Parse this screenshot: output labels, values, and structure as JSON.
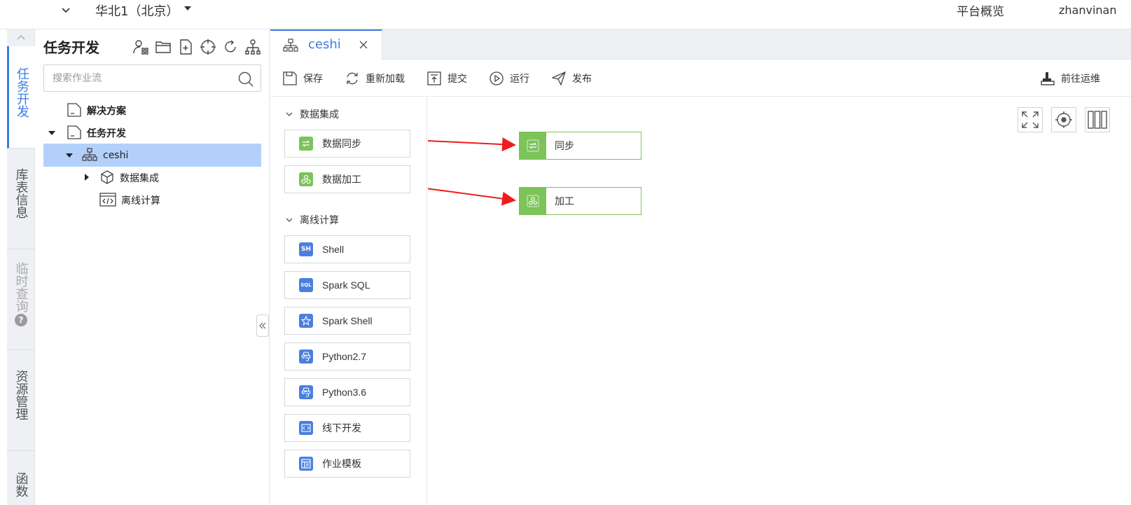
{
  "topbar": {
    "region": "华北1（北京）",
    "overview": "平台概览",
    "user": "zhanvinan"
  },
  "leftnav": {
    "items": [
      {
        "label": "任务开发",
        "state": "active"
      },
      {
        "label": "库表信息",
        "state": "normal"
      },
      {
        "label": "临时查询",
        "state": "disabled"
      },
      {
        "label": "资源管理",
        "state": "normal"
      },
      {
        "label": "函数",
        "state": "normal"
      }
    ]
  },
  "treepanel": {
    "title": "任务开发",
    "search_placeholder": "搜索作业流",
    "rows": [
      {
        "label": "解决方案"
      },
      {
        "label": "任务开发"
      },
      {
        "label": "ceshi"
      },
      {
        "label": "数据集成"
      },
      {
        "label": "离线计算"
      }
    ]
  },
  "editor": {
    "tab": {
      "label": "ceshi"
    },
    "toolbar": {
      "save": "保存",
      "reload": "重新加载",
      "submit": "提交",
      "run": "运行",
      "publish": "发布",
      "ops": "前往运维"
    },
    "palette": {
      "groups": [
        {
          "label": "数据集成",
          "items": [
            {
              "label": "数据同步",
              "icon": "sync-icon"
            },
            {
              "label": "数据加工",
              "icon": "process-icon"
            }
          ]
        },
        {
          "label": "离线计算",
          "items": [
            {
              "label": "Shell",
              "icon": "shell-icon",
              "icon_text": "SH"
            },
            {
              "label": "Spark SQL",
              "icon": "sql-icon",
              "icon_text": "SQL"
            },
            {
              "label": "Spark Shell",
              "icon": "spark-icon"
            },
            {
              "label": "Python2.7",
              "icon": "python-icon"
            },
            {
              "label": "Python3.6",
              "icon": "python-icon"
            },
            {
              "label": "线下开发",
              "icon": "code-icon"
            },
            {
              "label": "作业模板",
              "icon": "template-icon"
            }
          ]
        }
      ]
    },
    "canvas": {
      "nodes": [
        {
          "label": "同步",
          "icon": "sync-icon"
        },
        {
          "label": "加工",
          "icon": "process-icon"
        }
      ]
    }
  },
  "colors": {
    "accent": "#3a7de0",
    "selected_row": "#b3d0fa",
    "node_green": "#7cc35a",
    "python_blue": "#4a7fe0",
    "arrow_red": "#f01c1c"
  }
}
